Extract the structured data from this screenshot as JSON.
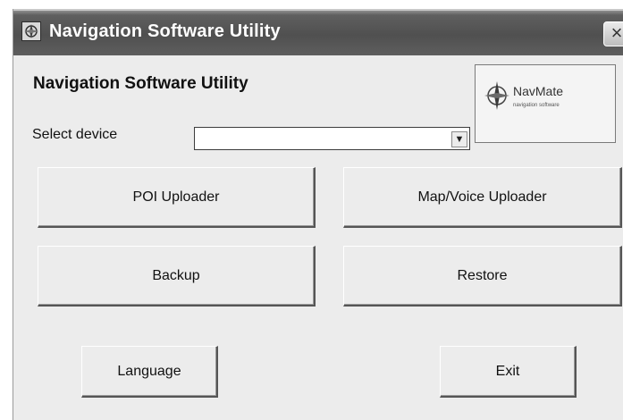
{
  "window": {
    "title": "Navigation Software Utility",
    "close_glyph": "×"
  },
  "main": {
    "heading": "Navigation Software Utility",
    "select_label": "Select device",
    "device_value": "",
    "dropdown_glyph": "▼"
  },
  "logo": {
    "name": "NavMate",
    "tagline": "navigation software"
  },
  "buttons": {
    "poi": "POI Uploader",
    "map_voice": "Map/Voice Uploader",
    "backup": "Backup",
    "restore": "Restore",
    "language": "Language",
    "exit": "Exit"
  },
  "icons": {
    "app": "app-icon",
    "logo": "compass-rose-icon",
    "close": "close-icon",
    "dropdown": "chevron-down-icon"
  }
}
